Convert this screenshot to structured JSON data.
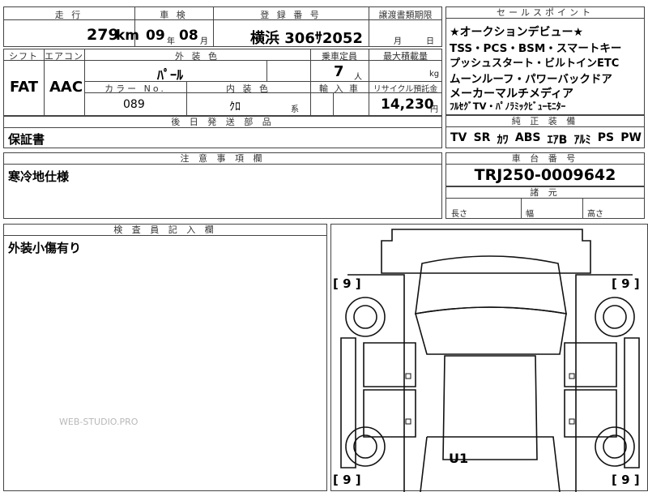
{
  "top": {
    "mileage_label": "走 行",
    "mileage_value": "279",
    "mileage_unit": "km",
    "inspection_label": "車 検",
    "inspection_year": "09",
    "inspection_year_unit": "年",
    "inspection_month": "08",
    "inspection_month_unit": "月",
    "registration_label": "登 録 番 号",
    "registration_value": "横浜 306ｻ2052",
    "transfer_label": "譲渡書類期限",
    "transfer_month_unit": "月",
    "transfer_day_unit": "日"
  },
  "second": {
    "shift_label": "シフト",
    "shift_value": "FAT",
    "aircon_label": "エアコン",
    "aircon_value": "AAC",
    "exterior_color_label": "外 装 色",
    "exterior_color_value": "ﾊﾟｰﾙ",
    "capacity_label": "乗車定員",
    "capacity_value": "7",
    "capacity_unit": "人",
    "max_load_label": "最大積載量",
    "max_load_unit": "kg",
    "color_no_label": "カラー No.",
    "color_no_value": "089",
    "interior_color_label": "内 装 色",
    "interior_color_value": "ｸﾛ",
    "interior_color_suffix": "系",
    "import_label": "輸 入 車",
    "recycle_label": "リサイクル預託金",
    "recycle_value": "14,230",
    "recycle_unit": "円"
  },
  "later_parts": {
    "label": "後 日 発 送 部 品",
    "value": "保証書"
  },
  "notes": {
    "label": "注 意 事 項 欄",
    "value": "寒冷地仕様"
  },
  "inspector": {
    "label": "検 査 員 記 入 欄",
    "value": "外装小傷有り"
  },
  "sales_points": {
    "label": "セールスポイント",
    "lines": [
      "★オークションデビュー★",
      "TSS・PCS・BSM・スマートキー",
      "プッシュスタート・ビルトインETC",
      "ムーンルーフ・パワーバックドア",
      "メーカーマルチメディア",
      "ﾌﾙｾｸﾞTV・ﾊﾟﾉﾗﾐｯｸﾋﾞｭｰﾓﾆﾀｰ"
    ]
  },
  "genuine_equipment": {
    "label": "純 正 装 備",
    "items": [
      "TV",
      "SR",
      "ｶﾜ",
      "ABS",
      "ｴｱB",
      "ｱﾙﾐ",
      "PS",
      "PW"
    ]
  },
  "chassis": {
    "label": "車 台 番 号",
    "value": "TRJ250-0009642"
  },
  "dimensions": {
    "label": "諸 元",
    "length_label": "長さ",
    "width_label": "幅",
    "height_label": "高さ"
  },
  "diagram": {
    "tire_marks": [
      "[ 9 ]",
      "[ 9 ]",
      "[ 9 ]",
      "[ 9 ]"
    ],
    "damage_code": "U1"
  },
  "watermark": "WEB-STUDIO.PRO"
}
